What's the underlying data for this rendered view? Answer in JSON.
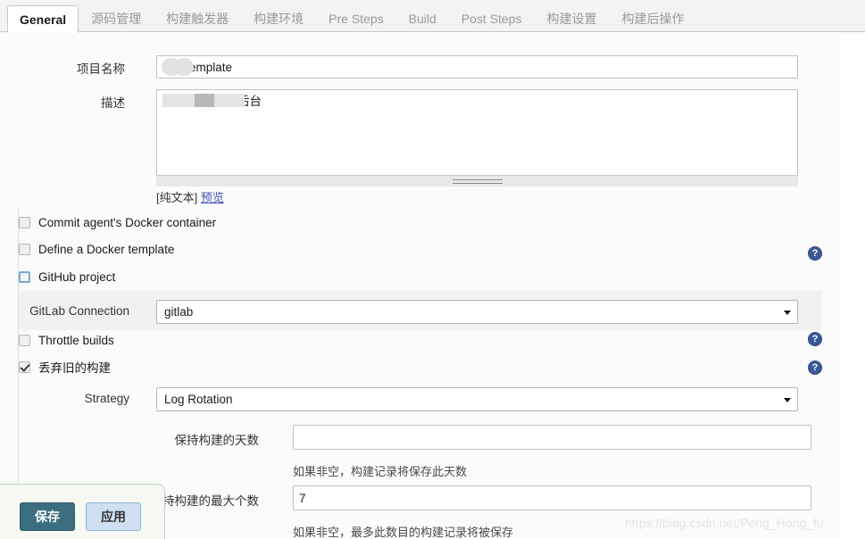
{
  "tabs": [
    {
      "label": "General",
      "active": true
    },
    {
      "label": "源码管理",
      "active": false
    },
    {
      "label": "构建触发器",
      "active": false
    },
    {
      "label": "构建环境",
      "active": false
    },
    {
      "label": "Pre Steps",
      "active": false
    },
    {
      "label": "Build",
      "active": false
    },
    {
      "label": "Post Steps",
      "active": false
    },
    {
      "label": "构建设置",
      "active": false
    },
    {
      "label": "构建后操作",
      "active": false
    }
  ],
  "form": {
    "project_name": {
      "label": "项目名称",
      "value": "y-template",
      "redacted": true
    },
    "description": {
      "label": "描述",
      "value": "测试环境后台",
      "redacted": true,
      "plain_text_label": "[纯文本]",
      "preview_link": "预览"
    },
    "checkboxes": [
      {
        "label": "Commit agent's Docker container",
        "checked": false,
        "focused": false
      },
      {
        "label": "Define a Docker template",
        "checked": false,
        "focused": false
      },
      {
        "label": "GitHub project",
        "checked": false,
        "focused": true
      },
      {
        "label": "Throttle builds",
        "checked": false,
        "focused": false
      },
      {
        "label": "丢弃旧的构建",
        "checked": true,
        "focused": false
      }
    ],
    "gitlab_connection": {
      "label": "GitLab Connection",
      "value": "gitlab"
    },
    "strategy": {
      "label": "Strategy",
      "value": "Log Rotation"
    },
    "days_to_keep": {
      "label": "保持构建的天数",
      "value": "",
      "hint": "如果非空，构建记录将保存此天数"
    },
    "num_to_keep": {
      "label": "保持构建的最大个数",
      "value": "7",
      "hint": "如果非空，最多此数目的构建记录将被保存"
    }
  },
  "savebar": {
    "save_label": "保存",
    "apply_label": "应用"
  },
  "watermark": "https://blog.csdn.net/Peng_Hong_fu"
}
